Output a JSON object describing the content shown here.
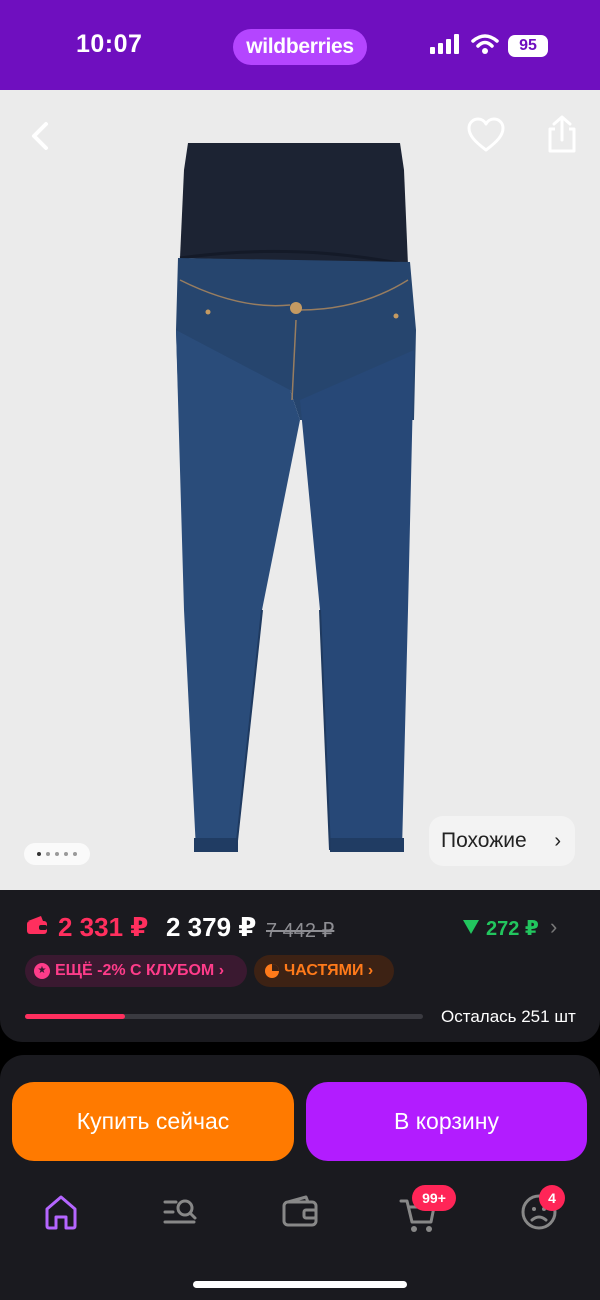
{
  "status_bar": {
    "time": "10:07",
    "brand": "wildberries",
    "battery": "95",
    "icons": [
      "signal-icon",
      "wifi-icon",
      "battery-icon"
    ],
    "background_color": "#6f0fbf"
  },
  "gallery": {
    "icons": [
      "back-arrow-icon",
      "heart-icon",
      "share-icon"
    ],
    "page_dots": 5,
    "active_dot": 1,
    "similar_label": "Похожие",
    "similar_chevron": "›"
  },
  "price": {
    "wallet_price": "2 331 ₽",
    "price": "2 379 ₽",
    "old_price": "7 442 ₽",
    "drop_value": "272 ₽",
    "drop_chevron": "›",
    "club_label": "ЕЩЁ -2% С КЛУБОМ ›",
    "parts_label": "ЧАСТЯМИ ›",
    "stock_text": "Осталась 251 шт",
    "stock_fraction": 0.25,
    "colors": {
      "accent_price": "#ff2f5e",
      "drop": "#22c55e",
      "club": "#ff3c8a",
      "parts": "#ff7a1a"
    }
  },
  "actions": {
    "buy_now": "Купить сейчас",
    "add_to_cart": "В корзину",
    "buy_color": "#ff7a00",
    "cart_color": "#b21cff"
  },
  "tab_bar": {
    "tabs": [
      "home-icon",
      "search-catalog-icon",
      "wallet-icon",
      "cart-icon",
      "profile-icon"
    ],
    "cart_badge": "99+",
    "profile_badge": "4"
  }
}
